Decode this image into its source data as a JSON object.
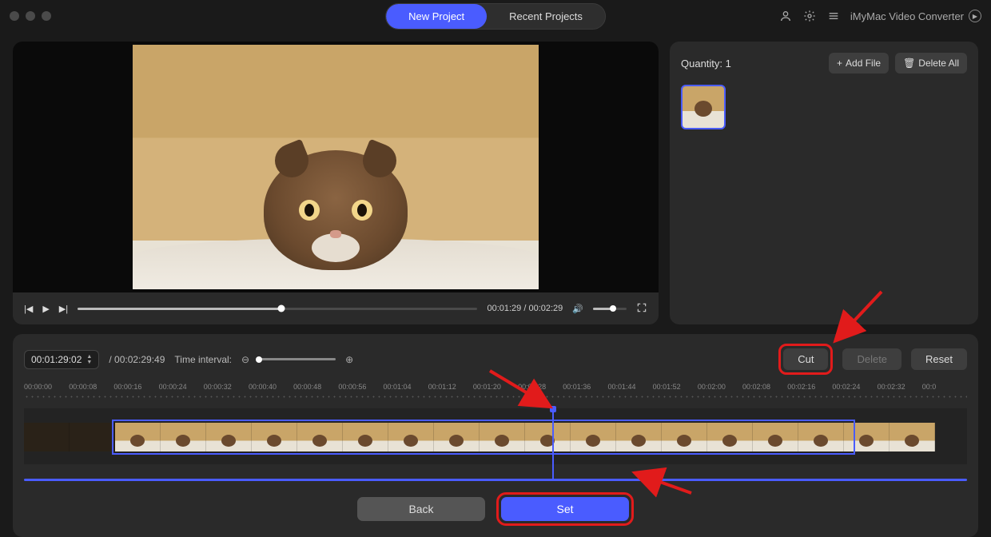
{
  "header": {
    "tabs": {
      "new_project": "New Project",
      "recent_projects": "Recent Projects"
    },
    "app_name": "iMyMac Video Converter"
  },
  "player": {
    "current_time": "00:01:29",
    "total_time": "00:02:29"
  },
  "side": {
    "quantity_label": "Quantity:",
    "quantity_value": "1",
    "add_file": "Add File",
    "delete_all": "Delete All"
  },
  "trim": {
    "timecode_in": "00:01:29:02",
    "timecode_total": "00:02:29:49",
    "time_interval_label": "Time interval:",
    "cut": "Cut",
    "delete": "Delete",
    "reset": "Reset"
  },
  "ruler_ticks": [
    "00:00:00",
    "00:00:08",
    "00:00:16",
    "00:00:24",
    "00:00:32",
    "00:00:40",
    "00:00:48",
    "00:00:56",
    "00:01:04",
    "00:01:12",
    "00:01:20",
    "00:01:28",
    "00:01:36",
    "00:01:44",
    "00:01:52",
    "00:02:00",
    "00:02:08",
    "00:02:16",
    "00:02:24",
    "00:02:32",
    "00:0"
  ],
  "bottom": {
    "back": "Back",
    "set": "Set"
  }
}
